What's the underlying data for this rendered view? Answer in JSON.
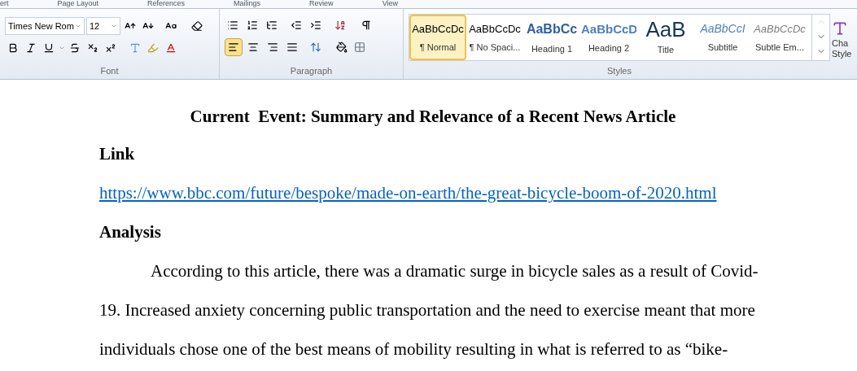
{
  "tabs": [
    {
      "label": "ert",
      "selected": false
    },
    {
      "label": "Page Layout",
      "selected": false
    },
    {
      "label": "References",
      "selected": false
    },
    {
      "label": "Mailings",
      "selected": false
    },
    {
      "label": "Review",
      "selected": false
    },
    {
      "label": "View",
      "selected": false
    }
  ],
  "font_group": {
    "font_name": "Times New Rom",
    "font_size": "12",
    "label": "Font"
  },
  "paragraph_group": {
    "label": "Paragraph",
    "alignments": [
      {
        "kind": "left",
        "selected": true
      },
      {
        "kind": "center",
        "selected": false
      },
      {
        "kind": "right",
        "selected": false
      },
      {
        "kind": "justify",
        "selected": false
      }
    ]
  },
  "styles_group": {
    "label": "Styles",
    "styles": [
      {
        "preview": "AaBbCcDc",
        "label": "¶ Normal",
        "kind": "normal",
        "selected": true
      },
      {
        "preview": "AaBbCcDc",
        "label": "¶ No Spaci...",
        "kind": "normal",
        "selected": false
      },
      {
        "preview": "AaBbCc",
        "label": "Heading 1",
        "kind": "heading1",
        "selected": false
      },
      {
        "preview": "AaBbCcD",
        "label": "Heading 2",
        "kind": "heading2",
        "selected": false
      },
      {
        "preview": "AaB",
        "label": "Title",
        "kind": "title",
        "selected": false
      },
      {
        "preview": "AaBbCcI",
        "label": "Subtitle",
        "kind": "subtitle",
        "selected": false
      },
      {
        "preview": "AaBbCcDc",
        "label": "Subtle Em...",
        "kind": "subtle",
        "selected": false
      }
    ]
  },
  "change_styles": {
    "label_line_1": "Cha",
    "label_line_2": "Style"
  },
  "document": {
    "title": "Current  Event: Summary and Relevance of a Recent News Article",
    "blocks": [
      {
        "kind": "heading",
        "text": "Link"
      },
      {
        "kind": "link",
        "text": "https://www.bbc.com/future/bespoke/made-on-earth/the-great-bicycle-boom-of-2020.html"
      },
      {
        "kind": "heading",
        "text": "Analysis"
      },
      {
        "kind": "paragraph",
        "text": "According to this article, there was a dramatic surge in bicycle sales as a result of Covid-19. Increased anxiety concerning public transportation and the need to exercise meant that more individuals chose one of the best means of mobility resulting in what is referred to as “bike-"
      }
    ]
  }
}
